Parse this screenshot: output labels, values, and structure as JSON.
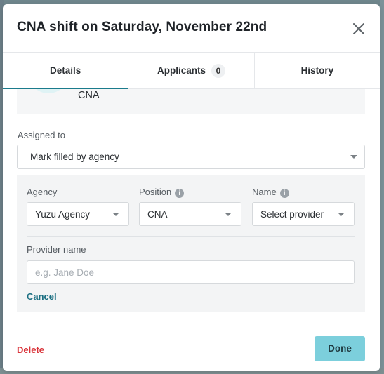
{
  "modal": {
    "title": "CNA shift on Saturday, November 22nd"
  },
  "tabs": [
    {
      "label": "Details",
      "active": true
    },
    {
      "label": "Applicants",
      "badge": "0",
      "active": false
    },
    {
      "label": "History",
      "active": false
    }
  ],
  "profile": {
    "role": "CNA"
  },
  "assigned_to": {
    "label": "Assigned to",
    "value": "Mark filled by agency"
  },
  "agency_panel": {
    "agency_label": "Agency",
    "agency_value": "Yuzu Agency",
    "position_label": "Position",
    "position_value": "CNA",
    "name_label": "Name",
    "name_value": "Select provider",
    "provider_label": "Provider name",
    "provider_placeholder": "e.g. Jane Doe",
    "provider_value": "",
    "cancel_label": "Cancel"
  },
  "footer": {
    "delete_label": "Delete",
    "done_label": "Done"
  },
  "colors": {
    "accent": "#1b7b8c",
    "done_button": "#7ccfdc",
    "delete": "#d9343a"
  }
}
